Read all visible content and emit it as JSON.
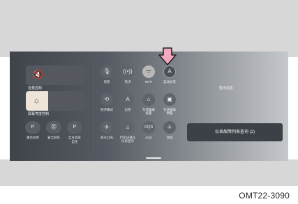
{
  "left_panel": {
    "volume": {
      "icon": "🔇",
      "label": "音量控制"
    },
    "brightness": {
      "icon": "☼",
      "label": "屏幕亮度控制",
      "level_fraction": 0.38
    },
    "bottom_buttons": [
      {
        "icon": "P",
        "label": "雷达驻停"
      },
      {
        "icon": "⛒",
        "label": "安全刹车"
      },
      {
        "icon": "P",
        "label": "自主泊车"
      }
    ],
    "bottom_button_labels_line2": [
      "",
      "",
      "自主"
    ]
  },
  "control_grid": {
    "row1": [
      {
        "icon": "🎙",
        "label": "语音"
      },
      {
        "icon": "((•))",
        "label": "热点"
      },
      {
        "icon": "ᯤ",
        "label": "Wi-Fi",
        "active": true
      },
      {
        "icon": "A",
        "label": "自动驻车"
      }
    ],
    "row2": [
      {
        "icon": "⟲",
        "label": "经济模式"
      },
      {
        "icon": "A",
        "label": "启停"
      },
      {
        "icon": "⌂",
        "label": "车道偏离",
        "label2": "报警"
      },
      {
        "icon": "▣",
        "label": "车道偏离",
        "label2": "预警"
      }
    ],
    "row3": [
      {
        "icon": "✈",
        "label": "前头灯光"
      },
      {
        "icon": "⌂",
        "label": "行车记录仪",
        "label2": "仪表显示"
      },
      {
        "icon": "AQS",
        "label": "AQS"
      },
      {
        "icon": "+",
        "label": "添加"
      }
    ]
  },
  "notifications": {
    "title": "暂无消息"
  },
  "fault_button": {
    "label": "仪表故障列表查询 (2)"
  },
  "caption": {
    "code": "OMT22-3090"
  },
  "colors": {
    "arrow_fill": "#f2a8c0",
    "arrow_stroke": "#222222"
  }
}
